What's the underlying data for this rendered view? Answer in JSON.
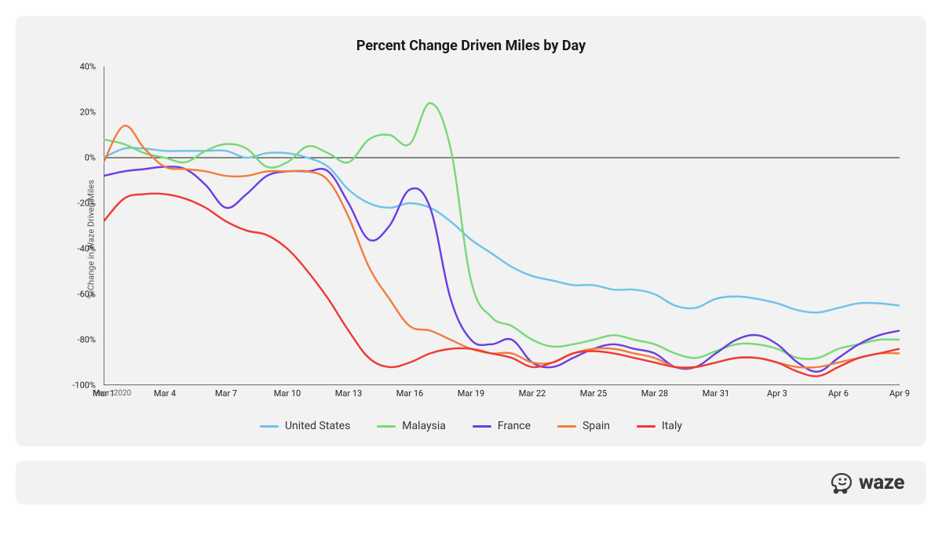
{
  "title": "Percent Change Driven Miles by Day",
  "ylabel": "% Change in Waze Driven Miles",
  "year_note": "Year: 2020",
  "brand": "waze",
  "chart_data": {
    "type": "line",
    "title": "Percent Change Driven Miles by Day",
    "xlabel": "",
    "ylabel": "% Change in Waze Driven Miles",
    "ylim": [
      -100,
      40
    ],
    "x_tick_labels": [
      "Mar 1",
      "Mar 4",
      "Mar 7",
      "Mar 10",
      "Mar 13",
      "Mar 16",
      "Mar 19",
      "Mar 22",
      "Mar 25",
      "Mar 28",
      "Mar 31",
      "Apr 3",
      "Apr 6",
      "Apr 9"
    ],
    "y_tick_labels": [
      "40%",
      "20%",
      "0%",
      "-20%",
      "-40%",
      "-60%",
      "-80%",
      "-100%"
    ],
    "y_tick_values": [
      40,
      20,
      0,
      -20,
      -40,
      -60,
      -80,
      -100
    ],
    "x": [
      1,
      2,
      3,
      4,
      5,
      6,
      7,
      8,
      9,
      10,
      11,
      12,
      13,
      14,
      15,
      16,
      17,
      18,
      19,
      20,
      21,
      22,
      23,
      24,
      25,
      26,
      27,
      28,
      29,
      30,
      31,
      32,
      33,
      34,
      35,
      36,
      37,
      38,
      39,
      40
    ],
    "series": [
      {
        "name": "United States",
        "color": "#6fc3e8",
        "values": [
          0,
          4,
          4,
          3,
          3,
          3,
          3,
          0,
          2,
          2,
          0,
          -4,
          -14,
          -20,
          -22,
          -20,
          -22,
          -28,
          -36,
          -42,
          -48,
          -52,
          -54,
          -56,
          -56,
          -58,
          -58,
          -60,
          -65,
          -66,
          -62,
          -61,
          -62,
          -64,
          -67,
          -68,
          -66,
          -64,
          -64,
          -65
        ]
      },
      {
        "name": "Malaysia",
        "color": "#77d977",
        "values": [
          8,
          6,
          2,
          0,
          -2,
          3,
          6,
          4,
          -4,
          -2,
          5,
          2,
          -2,
          8,
          10,
          6,
          24,
          4,
          -54,
          -70,
          -74,
          -80,
          -83,
          -82,
          -80,
          -78,
          -80,
          -82,
          -86,
          -88,
          -85,
          -82,
          -82,
          -84,
          -88,
          -88,
          -84,
          -82,
          -80,
          -80
        ]
      },
      {
        "name": "France",
        "color": "#6b3fe0",
        "values": [
          -8,
          -6,
          -5,
          -4,
          -5,
          -12,
          -22,
          -16,
          -8,
          -6,
          -6,
          -6,
          -20,
          -36,
          -30,
          -14,
          -22,
          -62,
          -80,
          -82,
          -80,
          -90,
          -92,
          -88,
          -84,
          -82,
          -84,
          -86,
          -92,
          -92,
          -86,
          -80,
          -78,
          -82,
          -90,
          -94,
          -88,
          -82,
          -78,
          -76
        ]
      },
      {
        "name": "Spain",
        "color": "#f07e3e",
        "values": [
          -2,
          14,
          4,
          -4,
          -5,
          -6,
          -8,
          -8,
          -6,
          -6,
          -6,
          -10,
          -26,
          -48,
          -62,
          -74,
          -76,
          -80,
          -84,
          -86,
          -86,
          -90,
          -90,
          -86,
          -84,
          -84,
          -86,
          -88,
          -92,
          -92,
          -90,
          -88,
          -88,
          -90,
          -92,
          -92,
          -90,
          -88,
          -86,
          -86
        ]
      },
      {
        "name": "Italy",
        "color": "#ef3a36",
        "values": [
          -28,
          -18,
          -16,
          -16,
          -18,
          -22,
          -28,
          -32,
          -34,
          -40,
          -50,
          -62,
          -76,
          -88,
          -92,
          -90,
          -86,
          -84,
          -84,
          -86,
          -88,
          -92,
          -90,
          -86,
          -85,
          -86,
          -88,
          -90,
          -92,
          -92,
          -90,
          -88,
          -88,
          -90,
          -94,
          -96,
          -92,
          -88,
          -86,
          -84
        ]
      }
    ]
  }
}
